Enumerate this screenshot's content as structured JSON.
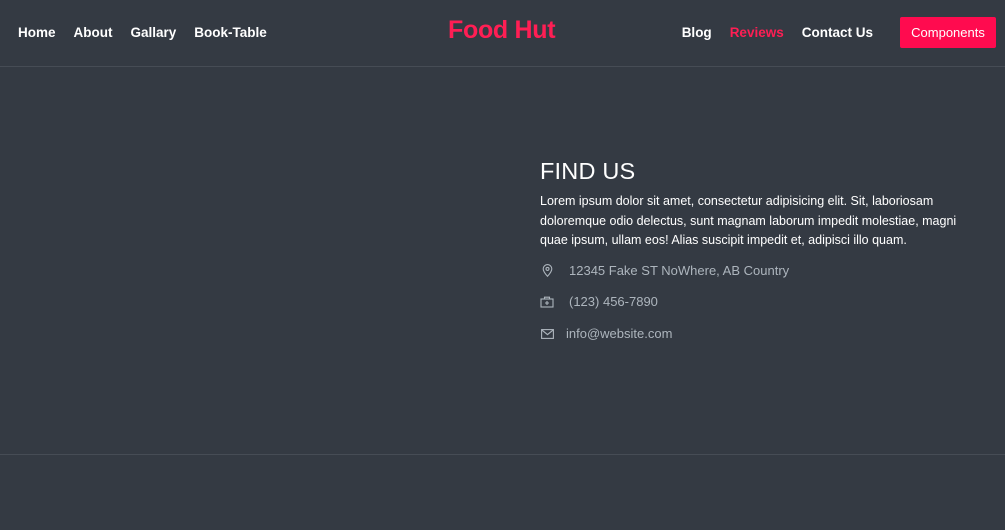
{
  "nav": {
    "left_links": [
      "Home",
      "About",
      "Gallary",
      "Book-Table"
    ],
    "brand": "Food Hut",
    "right_links": [
      "Blog",
      "Reviews",
      "Contact Us"
    ],
    "active_link": "Reviews",
    "cta_label": "Components"
  },
  "find_us": {
    "title": "FIND US",
    "description": "Lorem ipsum dolor sit amet, consectetur adipisicing elit. Sit, laboriosam doloremque odio delectus, sunt magnam laborum impedit molestiae, magni quae ipsum, ullam eos! Alias suscipit impedit et, adipisci illo quam.",
    "address": "12345 Fake ST NoWhere, AB Country",
    "phone": "(123) 456-7890",
    "email": "info@website.com"
  },
  "icons": {
    "address": "map-pin-icon",
    "phone": "phone-box-icon",
    "email": "envelope-icon"
  },
  "colors": {
    "background": "#343a43",
    "accent": "#ff1e54",
    "button": "#ff0b4f",
    "muted_text": "#adb5bd"
  }
}
